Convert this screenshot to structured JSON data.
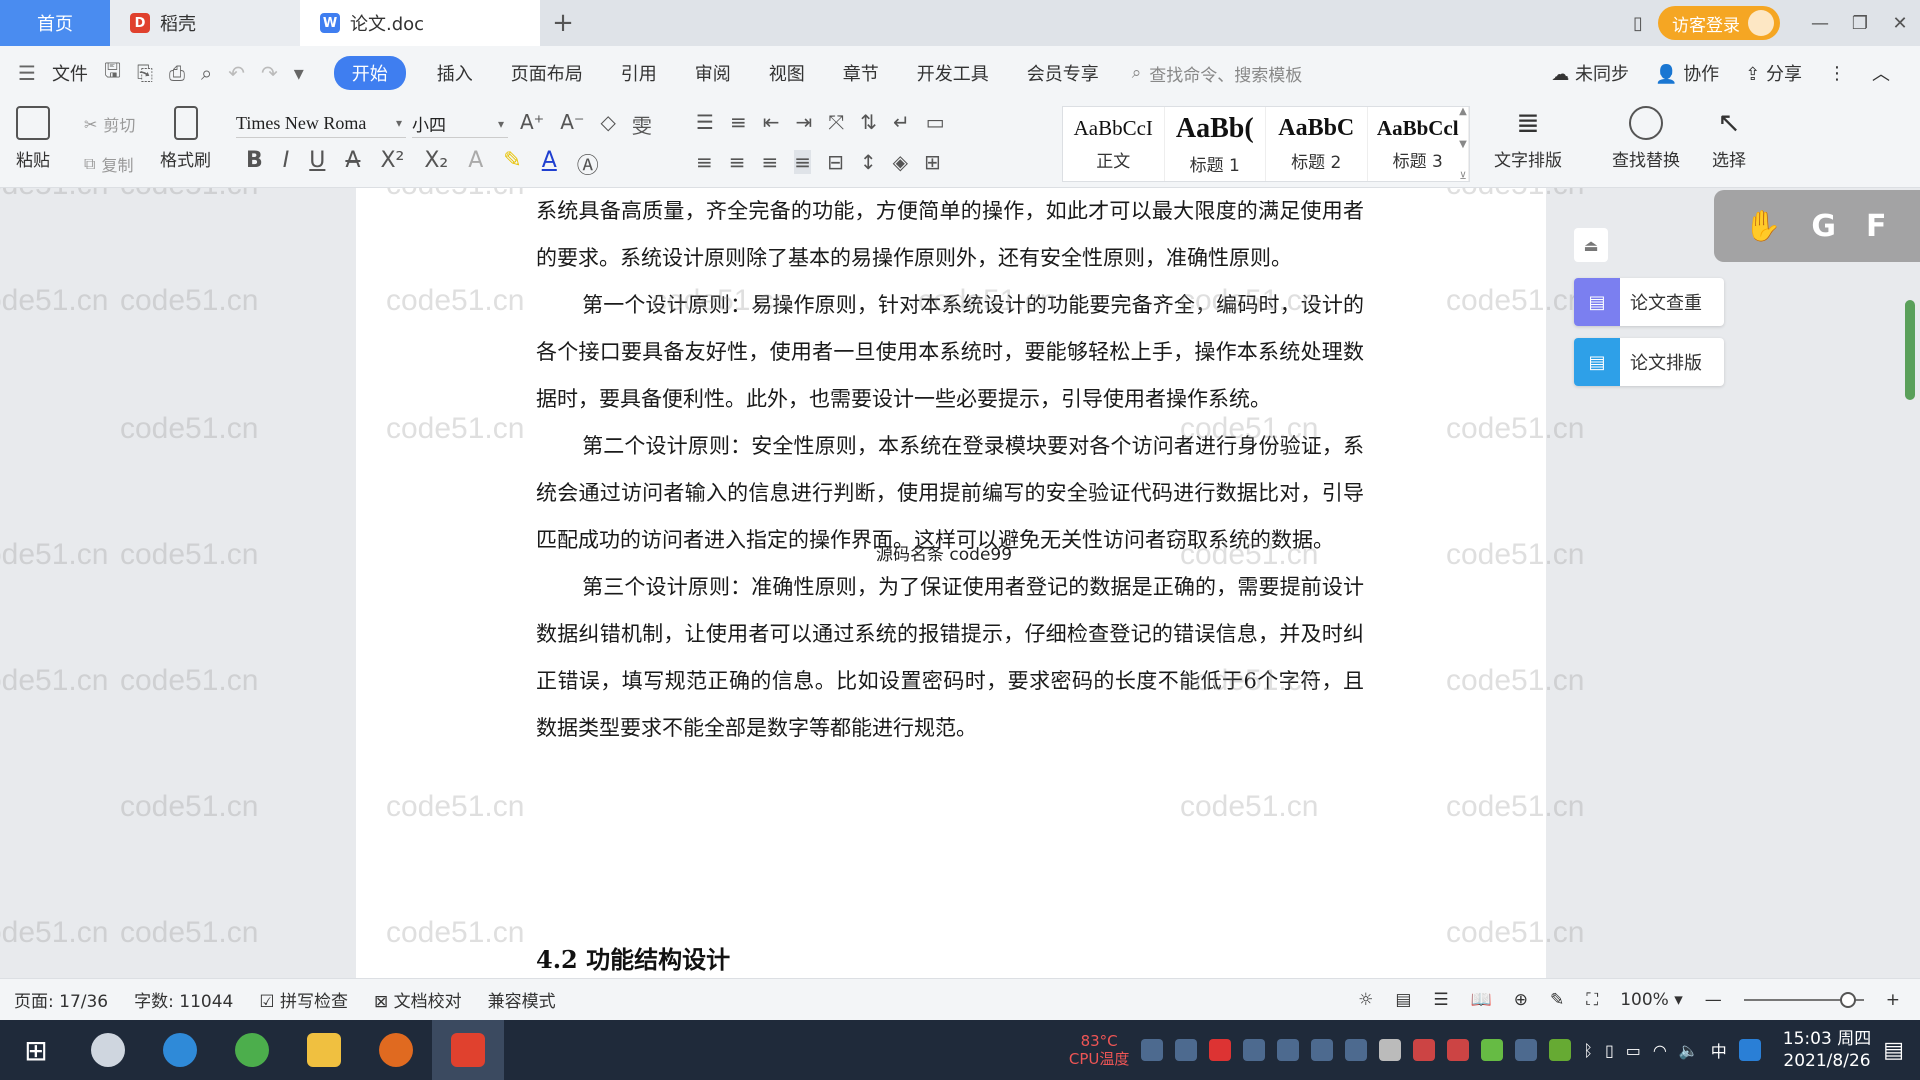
{
  "tabs": {
    "home": "首页",
    "daoke": "稻壳",
    "doc": "论文.doc",
    "visitor_login": "访客登录"
  },
  "menu": {
    "file": "文件",
    "items": [
      "开始",
      "插入",
      "页面布局",
      "引用",
      "审阅",
      "视图",
      "章节",
      "开发工具",
      "会员专享"
    ],
    "search_placeholder": "查找命令、搜索模板",
    "sync": "未同步",
    "collab": "协作",
    "share": "分享"
  },
  "ribbon": {
    "paste": "粘贴",
    "cut": "剪切",
    "copy": "复制",
    "format_painter": "格式刷",
    "font": "Times New Roma",
    "size": "小四",
    "styles": [
      {
        "sample": "AaBbCcI",
        "label": "正文"
      },
      {
        "sample": "AaBb(",
        "label": "标题 1"
      },
      {
        "sample": "AaBbC",
        "label": "标题 2"
      },
      {
        "sample": "AaBbCcl",
        "label": "标题 3"
      }
    ],
    "text_layout": "文字排版",
    "find_replace": "查找替换",
    "select": "选择"
  },
  "document": {
    "paragraphs": [
      "系统具备高质量，齐全完备的功能，方便简单的操作，如此才可以最大限度的满足使用者的要求。系统设计原则除了基本的易操作原则外，还有安全性原则，准确性原则。",
      "第一个设计原则：易操作原则，针对本系统设计的功能要完备齐全，编码时，设计的各个接口要具备友好性，使用者一旦使用本系统时，要能够轻松上手，操作本系统处理数据时，要具备便利性。此外，也需要设计一些必要提示，引导使用者操作系统。",
      "第二个设计原则：安全性原则，本系统在登录模块要对各个访问者进行身份验证，系统会通过访问者输入的信息进行判断，使用提前编写的安全验证代码进行数据比对，引导匹配成功的访问者进入指定的操作界面。这样可以避免无关性访问者窃取系统的数据。",
      "第三个设计原则：准确性原则，为了保证使用者登记的数据是正确的，需要提前设计数据纠错机制，让使用者可以通过系统的报错提示，仔细检查登记的错误信息，并及时纠正错误，填写规范正确的信息。比如设置密码时，要求密码的长度不能低于6个字符，且数据类型要求不能全部是数字等都能进行规范。"
    ],
    "heading": "4.2  功能结构设计",
    "overlay": "源码名条 code99"
  },
  "watermark": "code51.cn",
  "side": {
    "check": "论文查重",
    "layout": "论文排版",
    "float_letters": [
      "G",
      "F"
    ]
  },
  "status": {
    "page": "页面: 17/36",
    "words": "字数: 11044",
    "spell": "拼写检查",
    "proof": "文档校对",
    "compat": "兼容模式",
    "zoom": "100%"
  },
  "taskbar": {
    "cpu_temp": "83°C",
    "cpu_label": "CPU温度",
    "time": "15:03 周四",
    "date": "2021/8/26",
    "ime": "中"
  },
  "colors": {
    "accent": "#3f7ef0",
    "visitor": "#f5a623",
    "wps_red": "#e0412e"
  }
}
